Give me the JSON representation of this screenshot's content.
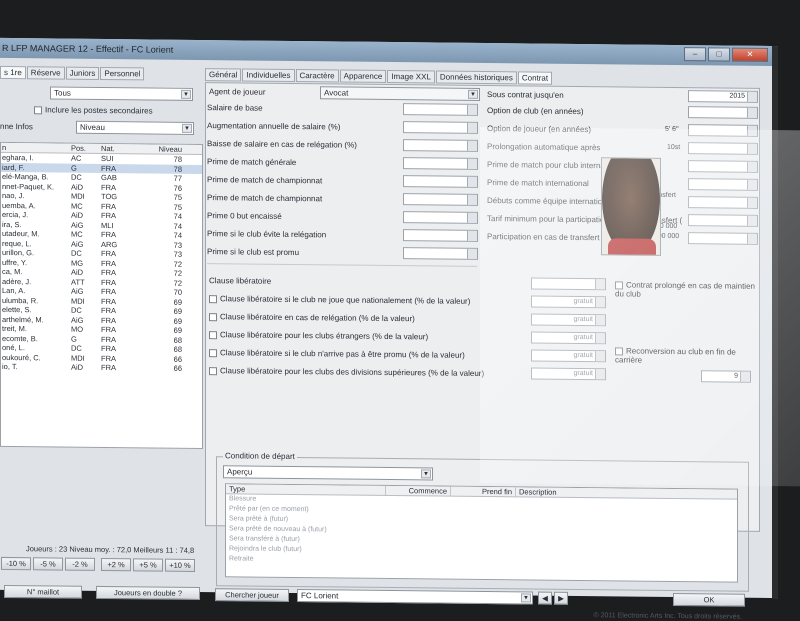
{
  "window": {
    "title": "R LFP MANAGER 12 - Effectif - FC Lorient",
    "controls": [
      "–",
      "□",
      "✕"
    ]
  },
  "left": {
    "tabs": [
      "s 1re",
      "Réserve",
      "Juniors",
      "Personnel"
    ],
    "filter_value": "Tous",
    "include_label": "Inclure les postes secondaires",
    "infos_label": "nne Infos",
    "infos_value": "Niveau",
    "columns": [
      "n",
      "Pos.",
      "Nat.",
      "Niveau"
    ],
    "players": [
      {
        "name": "eghara, I.",
        "pos": "AC",
        "nat": "SUI",
        "lvl": "78"
      },
      {
        "name": "iard, F.",
        "pos": "G",
        "nat": "FRA",
        "lvl": "78"
      },
      {
        "name": "elé-Manga, B.",
        "pos": "DC",
        "nat": "GAB",
        "lvl": "77"
      },
      {
        "name": "nnet-Paquet, K.",
        "pos": "AiD",
        "nat": "FRA",
        "lvl": "76"
      },
      {
        "name": "nao, J.",
        "pos": "MDI",
        "nat": "TOG",
        "lvl": "75"
      },
      {
        "name": "uemba, A.",
        "pos": "MC",
        "nat": "FRA",
        "lvl": "75"
      },
      {
        "name": "ercia, J.",
        "pos": "AiD",
        "nat": "FRA",
        "lvl": "74"
      },
      {
        "name": "ira, S.",
        "pos": "AiG",
        "nat": "MLI",
        "lvl": "74"
      },
      {
        "name": "utadeur, M.",
        "pos": "MC",
        "nat": "FRA",
        "lvl": "74"
      },
      {
        "name": "reque, L.",
        "pos": "AiG",
        "nat": "ARG",
        "lvl": "73"
      },
      {
        "name": "urillon, G.",
        "pos": "DC",
        "nat": "FRA",
        "lvl": "73"
      },
      {
        "name": "uffre, Y.",
        "pos": "MG",
        "nat": "FRA",
        "lvl": "72"
      },
      {
        "name": "ca, M.",
        "pos": "AiD",
        "nat": "FRA",
        "lvl": "72"
      },
      {
        "name": "adère, J.",
        "pos": "ATT",
        "nat": "FRA",
        "lvl": "72"
      },
      {
        "name": "Lan, A.",
        "pos": "AiG",
        "nat": "FRA",
        "lvl": "70"
      },
      {
        "name": "ulumba, R.",
        "pos": "MDI",
        "nat": "FRA",
        "lvl": "69"
      },
      {
        "name": "elette, S.",
        "pos": "DC",
        "nat": "FRA",
        "lvl": "69"
      },
      {
        "name": "arthelmé, M.",
        "pos": "AiG",
        "nat": "FRA",
        "lvl": "69"
      },
      {
        "name": "treit, M.",
        "pos": "MO",
        "nat": "FRA",
        "lvl": "69"
      },
      {
        "name": "ecomte, B.",
        "pos": "G",
        "nat": "FRA",
        "lvl": "68"
      },
      {
        "name": "oné, L.",
        "pos": "DC",
        "nat": "FRA",
        "lvl": "68"
      },
      {
        "name": "oukouré, C.",
        "pos": "MDI",
        "nat": "FRA",
        "lvl": "66"
      },
      {
        "name": "io, T.",
        "pos": "AiD",
        "nat": "FRA",
        "lvl": "66"
      }
    ],
    "stats": "Joueurs : 23    Niveau moy. : 72,0   Meilleurs 11 : 74,8",
    "pct_buttons": [
      "-10 %",
      "-5 %",
      "-2 %",
      "+2 %",
      "+5 %",
      "+10 %"
    ],
    "btn_maillot": "N° maillot",
    "btn_double": "Joueurs en double ?"
  },
  "right": {
    "tabs": [
      "Général",
      "Individuelles",
      "Caractère",
      "Apparence",
      "Image XXL",
      "Données historiques",
      "Contrat"
    ],
    "agent_label": "Agent de joueur",
    "agent_value": "Avocat",
    "fields_left": [
      "Salaire de base",
      "Augmentation annuelle de salaire (%)",
      "Baisse de salaire en cas de relégation (%)",
      "Prime de match générale",
      "Prime de match de championnat",
      "Prime de match de championnat",
      "Prime 0 but encaissé",
      "Prime si le club évite la relégation",
      "Prime si le club est promu"
    ],
    "fields_right": [
      "Sous contrat jusqu'en",
      "Option de club (en années)",
      "Option de joueur (en années)",
      "Prolongation automatique après",
      "Prime de match pour club international",
      "Prime de match international",
      "Débuts comme équipe internationale",
      "Tarif minimum pour la participation en cas de transfert (",
      "Participation en cas de transfert (%)"
    ],
    "contract_year": "2015",
    "height_value": "5' 6\"",
    "weight_value": "10st",
    "frais_label": "Frais de transfert",
    "tarif_value": "150 000",
    "participation_value": "2 500 000",
    "clause_label": "Clause libératoire",
    "clauses": [
      "Clause libératoire si le club ne joue que nationalement (% de la valeur)",
      "Clause libératoire en cas de relégation (% de la valeur)",
      "Clause libératoire pour les clubs étrangers (% de la valeur)",
      "Clause libératoire si le club n'arrive pas à être promu (% de la valeur)",
      "Clause libératoire pour les clubs des divisions supérieures (% de la valeur)"
    ],
    "gratuit": "gratuit",
    "prolonge_label": "Contrat prolongé en cas de maintien du club",
    "reconversion_label": "Reconversion au club en fin de carrière",
    "reconversion_value": "9",
    "depart_title": "Condition de départ",
    "depart_select": "Aperçu",
    "depart_columns": [
      "Type",
      "Commence",
      "Prend fin",
      "Description"
    ],
    "depart_rows": [
      "Blessure",
      "Prêté par (en ce moment)",
      "Sera prêté à (futur)",
      "Sera prêté de nouveau à (futur)",
      "Sera transféré à (futur)",
      "Rejoindra le club (futur)",
      "Retraite"
    ],
    "btn_search": "Chercher joueur",
    "club_value": "FC Lorient",
    "btn_ok": "OK",
    "copyright": "© 2011 Electronic Arts Inc. Tous droits réservés."
  }
}
